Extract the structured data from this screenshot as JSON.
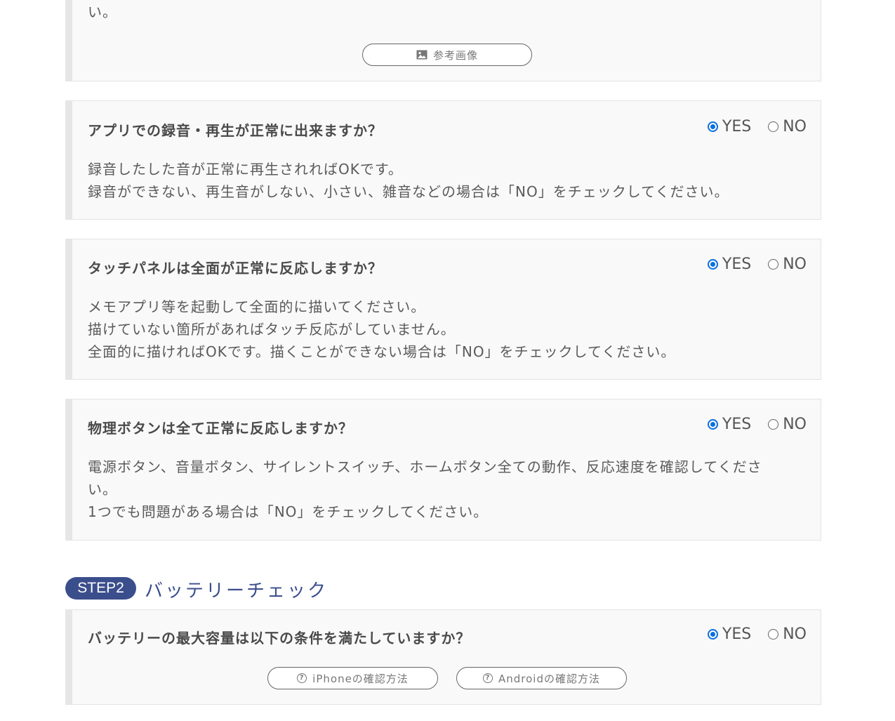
{
  "card0": {
    "desc_tail": "い。",
    "ref_button": "参考画像",
    "ref_icon": "image-icon"
  },
  "radio_labels": {
    "yes": "YES",
    "no": "NO"
  },
  "questions": [
    {
      "title": "アプリでの録音・再生が正常に出来ますか？",
      "selected": "YES",
      "lines": [
        "録音したした音が正常に再生されればOKです。",
        "録音ができない、再生音がしない、小さい、雑音などの場合は「NO」をチェックしてください。"
      ]
    },
    {
      "title": "タッチパネルは全面が正常に反応しますか？",
      "selected": "YES",
      "lines": [
        "メモアプリ等を起動して全面的に描いてください。",
        "描けていない箇所があればタッチ反応がしていません。",
        "全面的に描ければOKです。描くことができない場合は「NO」をチェックしてください。"
      ]
    },
    {
      "title": "物理ボタンは全て正常に反応しますか？",
      "selected": "YES",
      "lines": [
        "電源ボタン、音量ボタン、サイレントスイッチ、ホームボタン全ての動作、反応速度を確認してくださ",
        "い。",
        "1つでも問題がある場合は「NO」をチェックしてください。"
      ]
    }
  ],
  "step2": {
    "badge": "STEP2",
    "title": "バッテリーチェック",
    "question": {
      "title": "バッテリーの最大容量は以下の条件を満たしていますか？",
      "selected": "YES"
    },
    "buttons": {
      "iphone": "iPhoneの確認方法",
      "android": "Androidの確認方法"
    }
  },
  "colors": {
    "accent": "#3b4e8c",
    "radio_checked": "#0b6fe0",
    "card_bg": "#f9f9f9"
  }
}
